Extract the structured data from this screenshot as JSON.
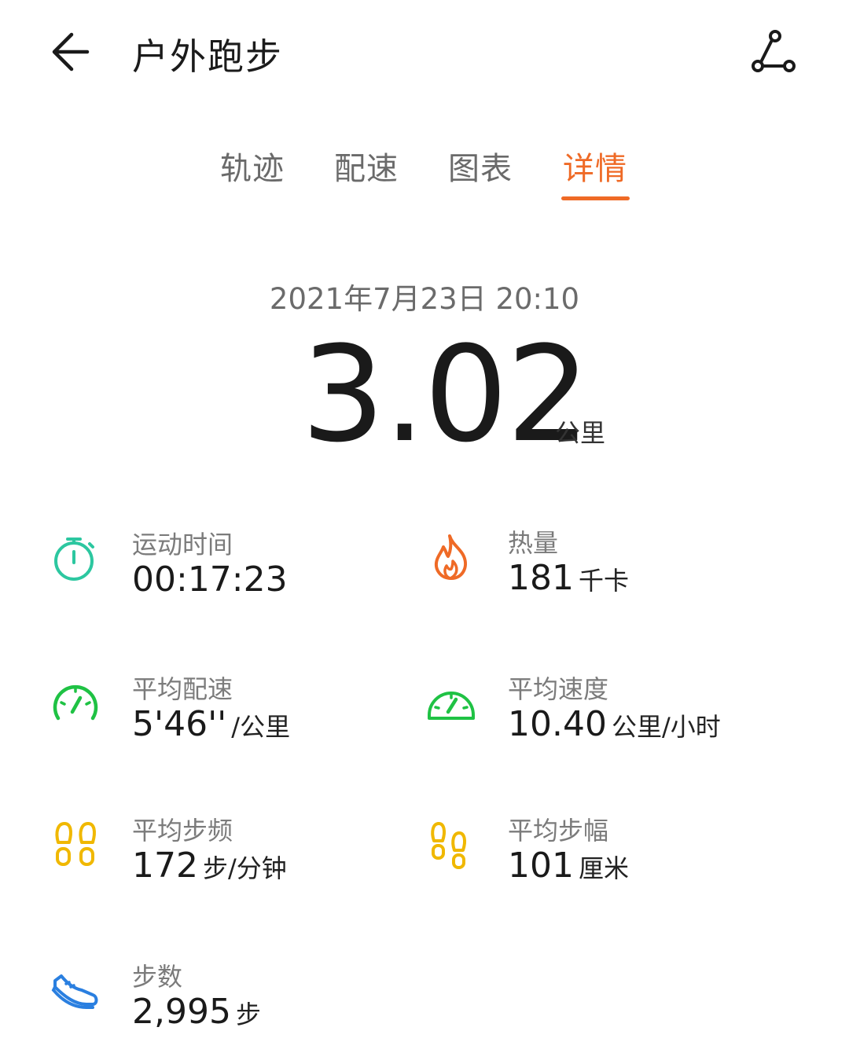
{
  "header": {
    "title": "户外跑步",
    "back_icon": "arrow-left-icon",
    "share_icon": "share-route-icon"
  },
  "tabs": [
    {
      "label": "轨迹",
      "active": false
    },
    {
      "label": "配速",
      "active": false
    },
    {
      "label": "图表",
      "active": false
    },
    {
      "label": "详情",
      "active": true
    }
  ],
  "summary": {
    "datetime": "2021年7月23日 20:10",
    "distance": "3.02",
    "distance_unit": "公里"
  },
  "metrics": [
    {
      "label": "运动时间",
      "value": "00:17:23",
      "unit": "",
      "icon": "stopwatch-icon",
      "color": "#2cc7a0"
    },
    {
      "label": "热量",
      "value": "181",
      "unit": "千卡",
      "icon": "flame-icon",
      "color": "#ef6a26"
    },
    {
      "label": "平均配速",
      "value": "5'46''",
      "unit": "/公里",
      "icon": "speedometer-icon",
      "color": "#1fc244"
    },
    {
      "label": "平均速度",
      "value": "10.40",
      "unit": "公里/小时",
      "icon": "gauge-icon",
      "color": "#1fc244"
    },
    {
      "label": "平均步频",
      "value": "172",
      "unit": "步/分钟",
      "icon": "footprints-icon",
      "color": "#f0b800"
    },
    {
      "label": "平均步幅",
      "value": "101",
      "unit": "厘米",
      "icon": "footsteps-icon",
      "color": "#f0b800"
    },
    {
      "label": "步数",
      "value": "2,995",
      "unit": "步",
      "icon": "shoe-icon",
      "color": "#2a7fe0"
    }
  ],
  "colors": {
    "accent": "#ef6a26",
    "text": "#1a1a1a",
    "muted": "#7b7b7b"
  }
}
